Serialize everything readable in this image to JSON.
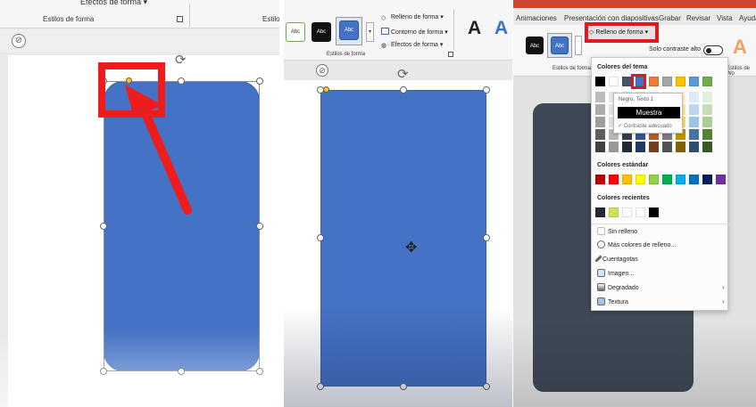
{
  "panel1": {
    "ribbon_top_cut": "Efectos de forma ▾",
    "ribbon_group_label": "Estilos de forma",
    "ribbon_group_label_right": "Estilos",
    "copilot_icon": "copilot-icon",
    "shape_color": "#4472c4",
    "annotation_color": "#ee1c1c"
  },
  "panel2": {
    "style_buttons": [
      "Abc",
      "Abc",
      "Abc"
    ],
    "commands": [
      "Relleno de forma ▾",
      "Contorno de forma ▾",
      "Efectos de forma ▾"
    ],
    "ribbon_group_label": "Estilos de forma",
    "wordart": [
      "A",
      "A"
    ],
    "shape_color": "#4472c4"
  },
  "panel3": {
    "tabs": [
      "Animaciones",
      "Presentación con diapositivas",
      "Grabar",
      "Revisar",
      "Vista",
      "Ayuda"
    ],
    "style_buttons": [
      "Abc",
      "Abc"
    ],
    "fill_button": "Relleno de forma ▾",
    "contrast_label": "Solo contraste alto",
    "wordart": "A",
    "ribbon_group_label": "Estilos de forma",
    "ribbon_group_label2": "Estilos de Wo",
    "shape_color": "#3f4956",
    "menu": {
      "theme_header": "Colores del tema",
      "theme_top_row": [
        "#000000",
        "#ffffff",
        "#44546a",
        "#4472c4",
        "#ed7d31",
        "#a5a5a5",
        "#ffc000",
        "#5b9bd5",
        "#70ad47"
      ],
      "tooltip_title": "Negro, Texto 1",
      "tooltip_sample": "Muestra",
      "tooltip_note": "✓ Contraste adecuado",
      "standard_header": "Colores estándar",
      "standard_colors": [
        "#c00000",
        "#ff0000",
        "#ffc000",
        "#ffff00",
        "#92d050",
        "#00b050",
        "#00b0f0",
        "#0070c0",
        "#002060",
        "#7030a0"
      ],
      "recent_header": "Colores recientes",
      "recent_colors": [
        "#262b33",
        "#d4e157",
        "#ffffff",
        "#ffffff",
        "#000000"
      ],
      "items": [
        "Sin relleno",
        "Más colores de relleno...",
        "Cuentagotas",
        "Imagen...",
        "Degradado",
        "Textura"
      ]
    }
  }
}
